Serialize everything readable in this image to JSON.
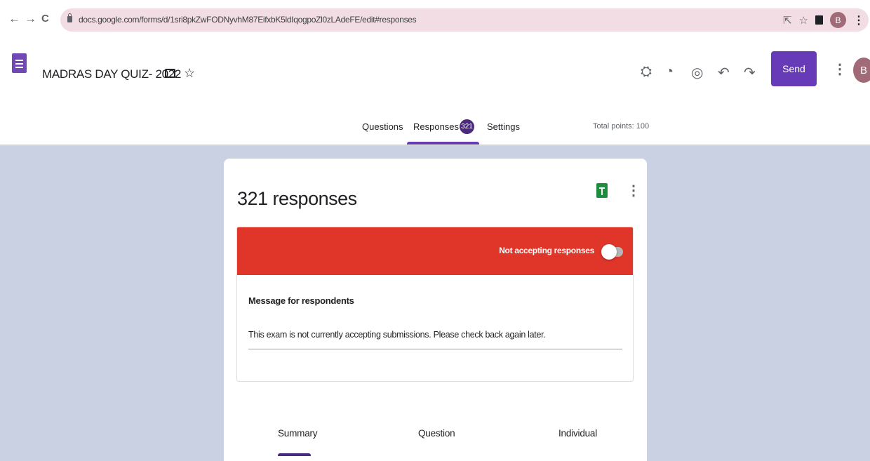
{
  "browser": {
    "back": "←",
    "forward": "→",
    "reload": "C",
    "url": "docs.google.com/forms/d/1sri8pkZwFODNyvhM87EifxbK5ldIqogpoZl0zLAdeFE/edit#responses",
    "share_icon": "share-icon",
    "star_icon": "☆",
    "profile_initial": "B",
    "menu_icon": "⋮"
  },
  "header": {
    "title": "MADRAS DAY QUIZ- 2022",
    "star_icon": "☆",
    "icons": [
      "addon-icon",
      "palette-icon",
      "preview-icon",
      "undo-icon",
      "redo-icon"
    ],
    "send_label": "Send",
    "more_icon": "⋮",
    "avatar_initial": "B",
    "accent_color": "#673ab7"
  },
  "tabs": {
    "questions": "Questions",
    "responses": "Responses",
    "responses_count": "321",
    "settings": "Settings",
    "total_points": "Total points: 100"
  },
  "card": {
    "title": "321 responses",
    "more_icon": "⋮",
    "accepting_label": "Not accepting responses",
    "accepting_on": false,
    "banner_color": "#e0362a",
    "message_label": "Message for respondents",
    "message_text": "This exam is not currently accepting submissions. Please check back again later."
  },
  "bottom_tabs": {
    "summary": "Summary",
    "question": "Question",
    "individual": "Individual"
  }
}
